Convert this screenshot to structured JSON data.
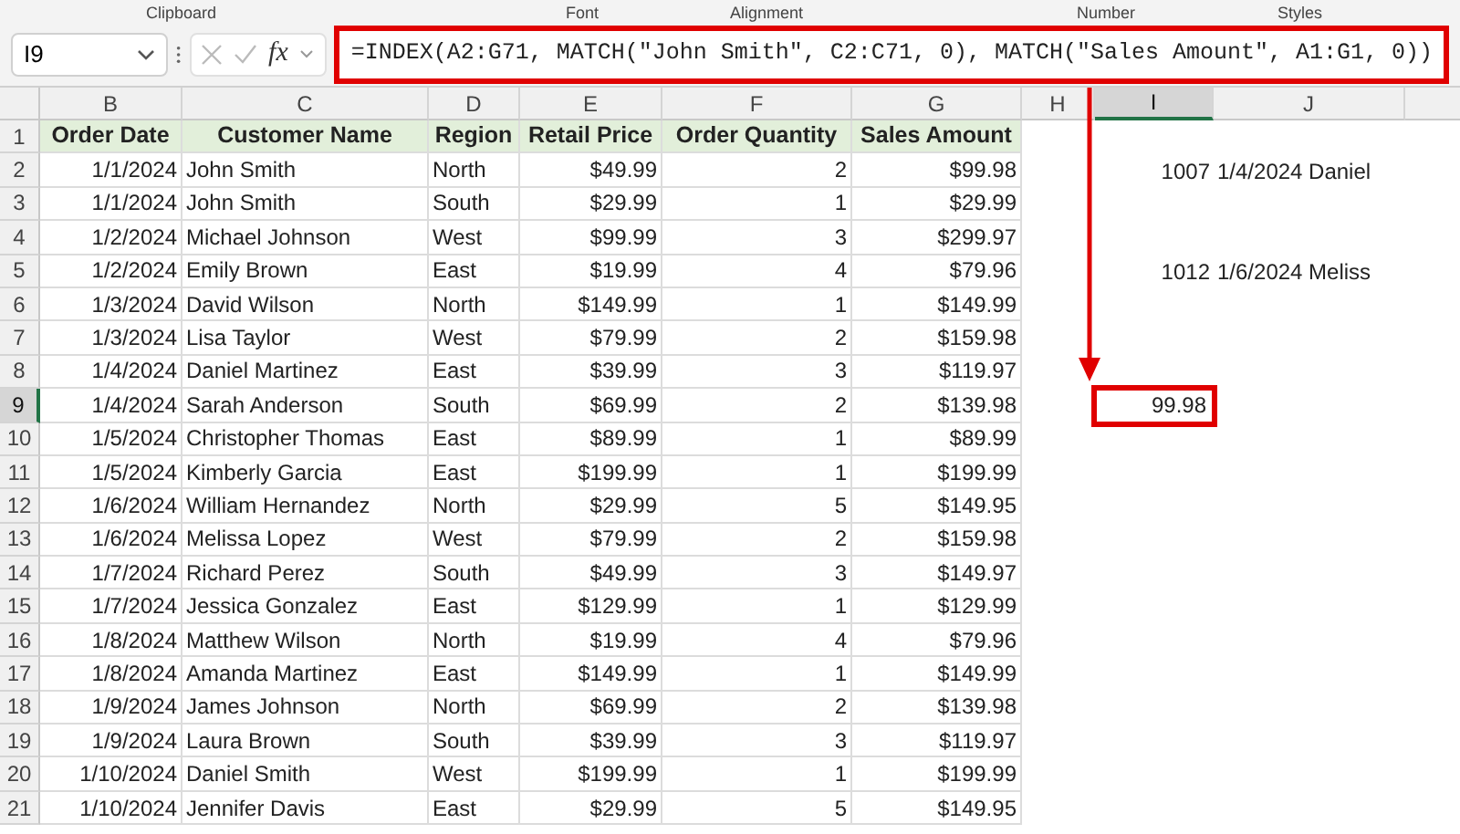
{
  "ribbon_groups": [
    "Clipboard",
    "Font",
    "Alignment",
    "Number",
    "Styles"
  ],
  "name_box": "I9",
  "function_label": "fx",
  "formula": "=INDEX(A2:G71, MATCH(\"John Smith\", C2:C71, 0), MATCH(\"Sales Amount\", A1:G1, 0))",
  "column_headers": [
    {
      "label": "B",
      "selected": false
    },
    {
      "label": "C",
      "selected": false
    },
    {
      "label": "D",
      "selected": false
    },
    {
      "label": "E",
      "selected": false
    },
    {
      "label": "F",
      "selected": false
    },
    {
      "label": "G",
      "selected": false
    },
    {
      "label": "H",
      "selected": false
    },
    {
      "label": "I",
      "selected": true
    },
    {
      "label": "J",
      "selected": false
    }
  ],
  "rows": [
    {
      "number": "1",
      "kind": "header",
      "selected": false,
      "cells": {
        "B": "Order Date",
        "C": "Customer Name",
        "D": "Region",
        "E": "Retail Price",
        "F": "Order Quantity",
        "G": "Sales Amount"
      }
    },
    {
      "number": "2",
      "kind": "data",
      "selected": false,
      "cells": {
        "B": "1/1/2024",
        "C": "John Smith",
        "D": "North",
        "E": "$49.99",
        "F": "2",
        "G": "$99.98",
        "I": "1007",
        "J": "1/4/2024 Daniel"
      }
    },
    {
      "number": "3",
      "kind": "data",
      "selected": false,
      "cells": {
        "B": "1/1/2024",
        "C": "John Smith",
        "D": "South",
        "E": "$29.99",
        "F": "1",
        "G": "$29.99"
      }
    },
    {
      "number": "4",
      "kind": "data",
      "selected": false,
      "cells": {
        "B": "1/2/2024",
        "C": "Michael Johnson",
        "D": "West",
        "E": "$99.99",
        "F": "3",
        "G": "$299.97"
      }
    },
    {
      "number": "5",
      "kind": "data",
      "selected": false,
      "cells": {
        "B": "1/2/2024",
        "C": "Emily Brown",
        "D": "East",
        "E": "$19.99",
        "F": "4",
        "G": "$79.96",
        "I": "1012",
        "J": "1/6/2024 Meliss"
      }
    },
    {
      "number": "6",
      "kind": "data",
      "selected": false,
      "cells": {
        "B": "1/3/2024",
        "C": "David Wilson",
        "D": "North",
        "E": "$149.99",
        "F": "1",
        "G": "$149.99"
      }
    },
    {
      "number": "7",
      "kind": "data",
      "selected": false,
      "cells": {
        "B": "1/3/2024",
        "C": "Lisa Taylor",
        "D": "West",
        "E": "$79.99",
        "F": "2",
        "G": "$159.98"
      }
    },
    {
      "number": "8",
      "kind": "data",
      "selected": false,
      "cells": {
        "B": "1/4/2024",
        "C": "Daniel Martinez",
        "D": "East",
        "E": "$39.99",
        "F": "3",
        "G": "$119.97"
      }
    },
    {
      "number": "9",
      "kind": "data",
      "selected": true,
      "cells": {
        "B": "1/4/2024",
        "C": "Sarah Anderson",
        "D": "South",
        "E": "$69.99",
        "F": "2",
        "G": "$139.98",
        "I": "99.98"
      }
    },
    {
      "number": "10",
      "kind": "data",
      "selected": false,
      "cells": {
        "B": "1/5/2024",
        "C": "Christopher Thomas",
        "D": "East",
        "E": "$89.99",
        "F": "1",
        "G": "$89.99"
      }
    },
    {
      "number": "11",
      "kind": "data",
      "selected": false,
      "cells": {
        "B": "1/5/2024",
        "C": "Kimberly Garcia",
        "D": "East",
        "E": "$199.99",
        "F": "1",
        "G": "$199.99"
      }
    },
    {
      "number": "12",
      "kind": "data",
      "selected": false,
      "cells": {
        "B": "1/6/2024",
        "C": "William Hernandez",
        "D": "North",
        "E": "$29.99",
        "F": "5",
        "G": "$149.95"
      }
    },
    {
      "number": "13",
      "kind": "data",
      "selected": false,
      "cells": {
        "B": "1/6/2024",
        "C": "Melissa Lopez",
        "D": "West",
        "E": "$79.99",
        "F": "2",
        "G": "$159.98"
      }
    },
    {
      "number": "14",
      "kind": "data",
      "selected": false,
      "cells": {
        "B": "1/7/2024",
        "C": "Richard Perez",
        "D": "South",
        "E": "$49.99",
        "F": "3",
        "G": "$149.97"
      }
    },
    {
      "number": "15",
      "kind": "data",
      "selected": false,
      "cells": {
        "B": "1/7/2024",
        "C": "Jessica Gonzalez",
        "D": "East",
        "E": "$129.99",
        "F": "1",
        "G": "$129.99"
      }
    },
    {
      "number": "16",
      "kind": "data",
      "selected": false,
      "cells": {
        "B": "1/8/2024",
        "C": "Matthew Wilson",
        "D": "North",
        "E": "$19.99",
        "F": "4",
        "G": "$79.96"
      }
    },
    {
      "number": "17",
      "kind": "data",
      "selected": false,
      "cells": {
        "B": "1/8/2024",
        "C": "Amanda Martinez",
        "D": "East",
        "E": "$149.99",
        "F": "1",
        "G": "$149.99"
      }
    },
    {
      "number": "18",
      "kind": "data",
      "selected": false,
      "cells": {
        "B": "1/9/2024",
        "C": "James Johnson",
        "D": "North",
        "E": "$69.99",
        "F": "2",
        "G": "$139.98"
      }
    },
    {
      "number": "19",
      "kind": "data",
      "selected": false,
      "cells": {
        "B": "1/9/2024",
        "C": "Laura Brown",
        "D": "South",
        "E": "$39.99",
        "F": "3",
        "G": "$119.97"
      }
    },
    {
      "number": "20",
      "kind": "data",
      "selected": false,
      "cells": {
        "B": "1/10/2024",
        "C": "Daniel Smith",
        "D": "West",
        "E": "$199.99",
        "F": "1",
        "G": "$199.99"
      }
    },
    {
      "number": "21",
      "kind": "data",
      "selected": false,
      "cells": {
        "B": "1/10/2024",
        "C": "Jennifer Davis",
        "D": "East",
        "E": "$29.99",
        "F": "5",
        "G": "$149.95"
      }
    }
  ]
}
